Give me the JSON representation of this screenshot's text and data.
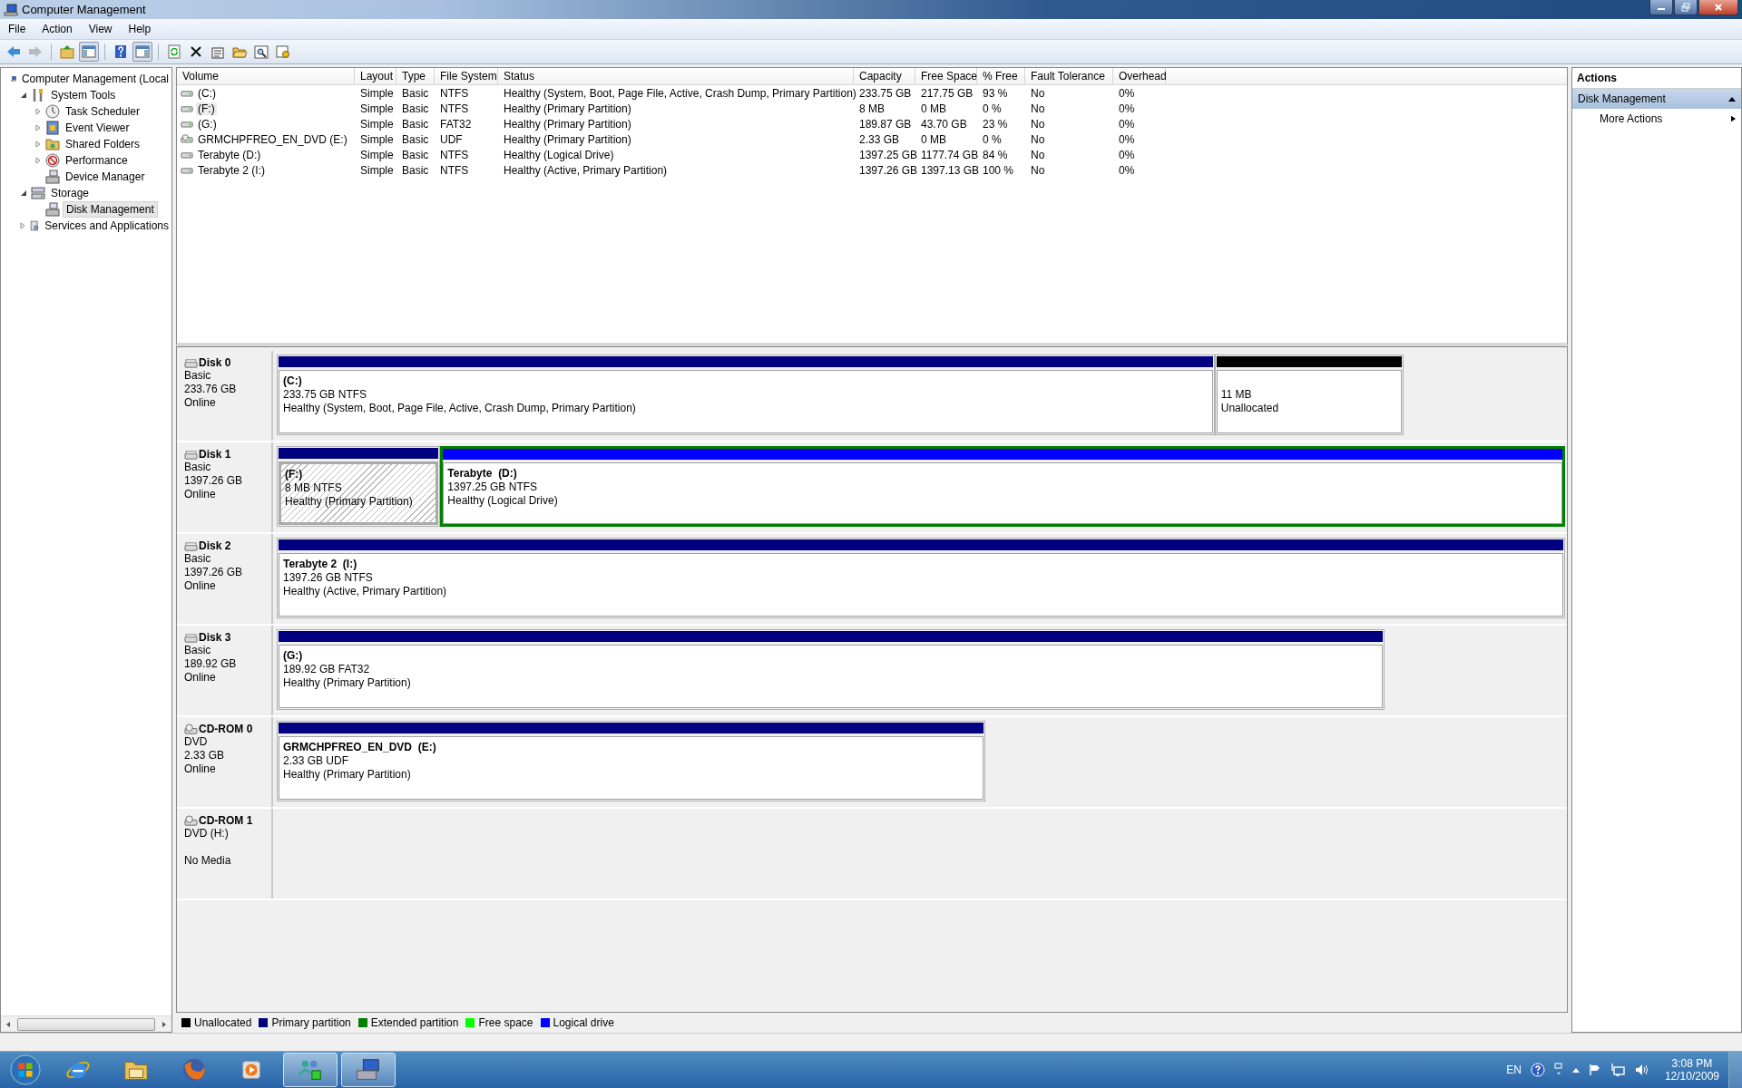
{
  "window": {
    "title": "Computer Management"
  },
  "menu": [
    "File",
    "Action",
    "View",
    "Help"
  ],
  "toolbar": [
    {
      "kind": "back",
      "enabled": true,
      "pressed": false
    },
    {
      "kind": "forward",
      "enabled": false,
      "pressed": false
    },
    {
      "kind": "sep"
    },
    {
      "kind": "up",
      "enabled": true,
      "pressed": false
    },
    {
      "kind": "tree",
      "enabled": true,
      "pressed": true
    },
    {
      "kind": "sep"
    },
    {
      "kind": "help",
      "enabled": true,
      "pressed": false
    },
    {
      "kind": "pane",
      "enabled": true,
      "pressed": true
    },
    {
      "kind": "sep"
    },
    {
      "kind": "refresh",
      "enabled": true,
      "pressed": false
    },
    {
      "kind": "delete",
      "enabled": true,
      "pressed": false
    },
    {
      "kind": "properties",
      "enabled": true,
      "pressed": false
    },
    {
      "kind": "open",
      "enabled": true,
      "pressed": false
    },
    {
      "kind": "find",
      "enabled": true,
      "pressed": false
    },
    {
      "kind": "rescan",
      "enabled": true,
      "pressed": false
    }
  ],
  "tree": [
    {
      "label": "Computer Management (Local",
      "kind": "computer",
      "selected": false,
      "children": [
        {
          "label": "System Tools",
          "kind": "tools",
          "selected": false,
          "expanded": true,
          "children": [
            {
              "label": "Task Scheduler",
              "kind": "clock",
              "selected": false,
              "expanded": false
            },
            {
              "label": "Event Viewer",
              "kind": "log",
              "selected": false,
              "expanded": false
            },
            {
              "label": "Shared Folders",
              "kind": "folder",
              "selected": false,
              "expanded": false
            },
            {
              "label": "Performance",
              "kind": "gauge",
              "selected": false,
              "expanded": false
            },
            {
              "label": "Device Manager",
              "kind": "device",
              "selected": false
            }
          ]
        },
        {
          "label": "Storage",
          "kind": "storage",
          "selected": false,
          "expanded": true,
          "children": [
            {
              "label": "Disk Management",
              "kind": "device",
              "selected": true
            }
          ]
        },
        {
          "label": "Services and Applications",
          "kind": "services",
          "selected": false,
          "expanded": false
        }
      ]
    }
  ],
  "table": {
    "columns": [
      "Volume",
      "Layout",
      "Type",
      "File System",
      "Status",
      "Capacity",
      "Free Space",
      "% Free",
      "Fault Tolerance",
      "Overhead"
    ],
    "rows": [
      {
        "kind": "disk",
        "selected": false,
        "cells": [
          "(C:)",
          "Simple",
          "Basic",
          "NTFS",
          "Healthy (System, Boot, Page File, Active, Crash Dump, Primary Partition)",
          "233.75 GB",
          "217.75 GB",
          "93 %",
          "No",
          "0%"
        ]
      },
      {
        "kind": "disk",
        "selected": true,
        "cells": [
          "(F:)",
          "Simple",
          "Basic",
          "NTFS",
          "Healthy (Primary Partition)",
          "8 MB",
          "0 MB",
          "0 %",
          "No",
          "0%"
        ]
      },
      {
        "kind": "disk",
        "selected": false,
        "cells": [
          "(G:)",
          "Simple",
          "Basic",
          "FAT32",
          "Healthy (Primary Partition)",
          "189.87 GB",
          "43.70 GB",
          "23 %",
          "No",
          "0%"
        ]
      },
      {
        "kind": "cd",
        "selected": false,
        "cells": [
          "GRMCHPFREO_EN_DVD (E:)",
          "Simple",
          "Basic",
          "UDF",
          "Healthy (Primary Partition)",
          "2.33 GB",
          "0 MB",
          "0 %",
          "No",
          "0%"
        ]
      },
      {
        "kind": "disk",
        "selected": false,
        "cells": [
          "Terabyte (D:)",
          "Simple",
          "Basic",
          "NTFS",
          "Healthy (Logical Drive)",
          "1397.25 GB",
          "1177.74 GB",
          "84 %",
          "No",
          "0%"
        ]
      },
      {
        "kind": "disk",
        "selected": false,
        "cells": [
          "Terabyte 2 (I:)",
          "Simple",
          "Basic",
          "NTFS",
          "Healthy (Active, Primary Partition)",
          "1397.26 GB",
          "1397.13 GB",
          "100 %",
          "No",
          "0%"
        ]
      }
    ]
  },
  "disks": [
    {
      "name": "Disk 0",
      "kind": "disk",
      "type": "Basic",
      "size": "233.76 GB",
      "status": "Online",
      "partitions": [
        {
          "kind": "primary",
          "selected": false,
          "title": "(C:)",
          "detail": "233.75 GB NTFS",
          "status": "Healthy (System, Boot, Page File, Active, Crash Dump, Primary Partition)"
        },
        {
          "kind": "unallocated",
          "selected": false,
          "detail": "11 MB",
          "status": "Unallocated"
        }
      ]
    },
    {
      "name": "Disk 1",
      "kind": "disk",
      "type": "Basic",
      "size": "1397.26 GB",
      "status": "Online",
      "partitions": [
        {
          "kind": "primary",
          "selected": true,
          "title": "(F:)",
          "detail": "8 MB NTFS",
          "status": "Healthy (Primary Partition)"
        },
        {
          "kind": "logical",
          "selected": false,
          "title": "Terabyte  (D:)",
          "detail": "1397.25 GB NTFS",
          "status": "Healthy (Logical Drive)"
        }
      ]
    },
    {
      "name": "Disk 2",
      "kind": "disk",
      "type": "Basic",
      "size": "1397.26 GB",
      "status": "Online",
      "partitions": [
        {
          "kind": "primary",
          "selected": false,
          "title": "Terabyte 2  (I:)",
          "detail": "1397.26 GB NTFS",
          "status": "Healthy (Active, Primary Partition)"
        }
      ]
    },
    {
      "name": "Disk 3",
      "kind": "disk",
      "type": "Basic",
      "size": "189.92 GB",
      "status": "Online",
      "partitions": [
        {
          "kind": "primary",
          "selected": false,
          "title": "(G:)",
          "detail": "189.92 GB FAT32",
          "status": "Healthy (Primary Partition)"
        }
      ]
    },
    {
      "name": "CD-ROM 0",
      "kind": "cdrom",
      "type": "DVD",
      "size": "2.33 GB",
      "status": "Online",
      "partitions": [
        {
          "kind": "primary",
          "selected": false,
          "title": "GRMCHPFREO_EN_DVD  (E:)",
          "detail": "2.33 GB UDF",
          "status": "Healthy (Primary Partition)"
        }
      ]
    },
    {
      "name": "CD-ROM 1",
      "kind": "cdrom",
      "type": "DVD (H:)",
      "status": "No Media"
    }
  ],
  "legend": [
    {
      "label": "Unallocated",
      "color": "#000000"
    },
    {
      "label": "Primary partition",
      "color": "#000080"
    },
    {
      "label": "Extended partition",
      "color": "#008000"
    },
    {
      "label": "Free space",
      "color": "#00ff00"
    },
    {
      "label": "Logical drive",
      "color": "#0000ff"
    }
  ],
  "actions": {
    "title": "Actions",
    "section": "Disk Management",
    "expanded": true,
    "items": [
      "More Actions"
    ]
  },
  "taskbar": {
    "apps": [
      {
        "kind": "ie",
        "open": false
      },
      {
        "kind": "explorer",
        "open": false
      },
      {
        "kind": "firefox",
        "open": false
      },
      {
        "kind": "media",
        "open": false
      },
      {
        "kind": "people",
        "open": true
      },
      {
        "kind": "management",
        "open": true
      }
    ],
    "language": "EN",
    "time": "3:08 PM",
    "date": "12/10/2009"
  }
}
